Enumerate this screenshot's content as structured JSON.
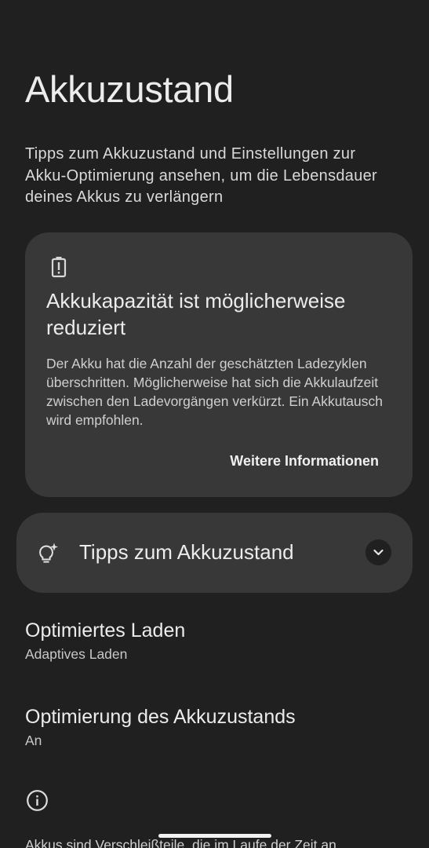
{
  "page": {
    "title": "Akkuzustand",
    "description": "Tipps zum Akkuzustand und Einstellungen zur Akku-Optimierung ansehen, um die Lebensdauer deines Akkus zu verlängern"
  },
  "alert_card": {
    "icon": "battery-alert-icon",
    "title": "Akkukapazität ist möglicherweise reduziert",
    "body": "Der Akku hat die Anzahl der geschätzten Ladezyklen überschritten. Möglicherweise hat sich die Akkulaufzeit zwischen den Ladevorgängen verkürzt. Ein Akkutausch wird empfohlen.",
    "link": "Weitere Informationen"
  },
  "tips": {
    "icon": "lightbulb-sparkle-icon",
    "label": "Tipps zum Akkuzustand",
    "expand_icon": "chevron-down-icon"
  },
  "settings": [
    {
      "title": "Optimiertes Laden",
      "subtitle": "Adaptives Laden"
    },
    {
      "title": "Optimierung des Akkuzustands",
      "subtitle": "An"
    }
  ],
  "footer": {
    "icon": "info-icon",
    "text": "Akkus sind Verschleißteile, die im Laufe der Zeit an"
  },
  "colors": {
    "background": "#202020",
    "card": "#383838",
    "text_primary": "#ececec",
    "text_secondary": "#c8c8c8"
  }
}
